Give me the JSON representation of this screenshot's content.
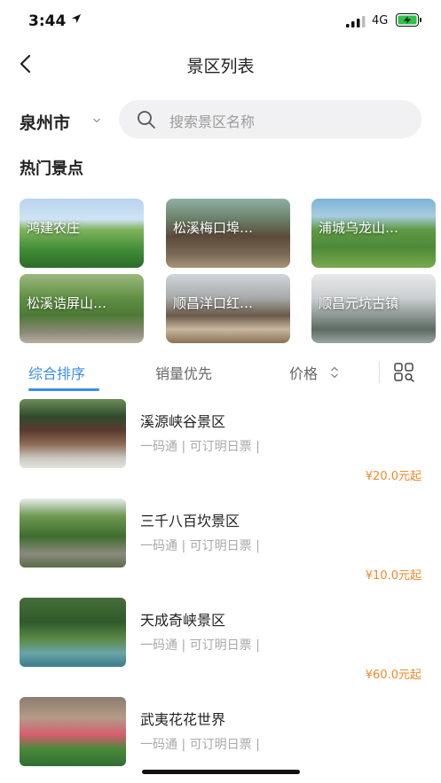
{
  "status": {
    "time": "3:44",
    "network": "4G"
  },
  "nav": {
    "title": "景区列表"
  },
  "filter": {
    "city": "泉州市",
    "search_placeholder": "搜索景区名称"
  },
  "hot": {
    "title": "热门景点",
    "items": [
      {
        "label": "鸿建农庄"
      },
      {
        "label": "松溪梅口埠…"
      },
      {
        "label": "浦城乌龙山…"
      },
      {
        "label": "松溪诰屏山…"
      },
      {
        "label": "顺昌洋口红…"
      },
      {
        "label": "顺昌元坑古镇"
      }
    ]
  },
  "tabs": {
    "items": [
      {
        "label": "综合排序",
        "active": true
      },
      {
        "label": "销量优先",
        "active": false
      },
      {
        "label": "价格",
        "active": false
      }
    ]
  },
  "spots": [
    {
      "name": "溪源峡谷景区",
      "tags": "一码通 | 可订明日票 |",
      "price": "¥20.0元起"
    },
    {
      "name": "三千八百坎景区",
      "tags": "一码通 | 可订明日票 |",
      "price": "¥10.0元起"
    },
    {
      "name": "天成奇峡景区",
      "tags": "一码通 | 可订明日票 |",
      "price": "¥60.0元起"
    },
    {
      "name": "武夷花花世界",
      "tags": "一码通 | 可订明日票 |",
      "price": ""
    }
  ],
  "colors": {
    "accent": "#3b8fe6",
    "price": "#f08a2a"
  }
}
